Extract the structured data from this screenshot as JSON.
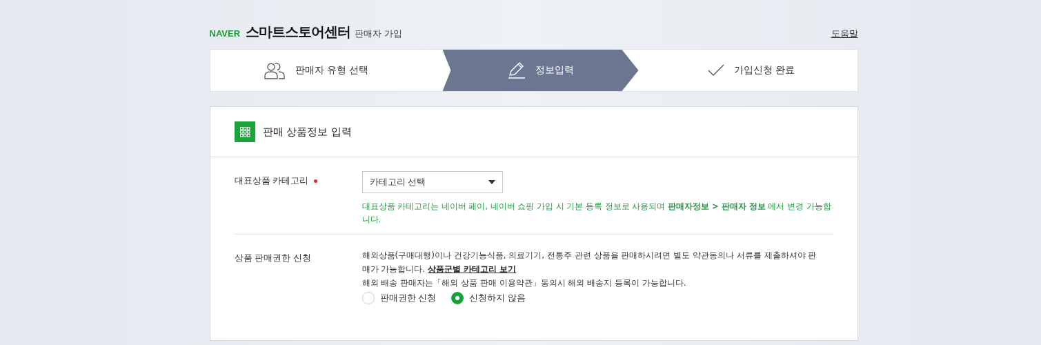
{
  "header": {
    "brand": "NAVER",
    "title": "스마트스토어센터",
    "subtitle": "판매자 가입",
    "help_link": "도움말"
  },
  "steps": [
    {
      "label": "판매자 유형 선택",
      "selected": false
    },
    {
      "label": "정보입력",
      "selected": true
    },
    {
      "label": "가입신청 완료",
      "selected": false
    }
  ],
  "section": {
    "title": "판매 상품정보 입력",
    "rows": [
      {
        "kind": "select",
        "label": "대표상품 카테고리",
        "required": true,
        "value": "카테고리 선택",
        "hint": "대표상품 카테고리는 네이버 페이, 네이버 쇼핑 가입 시 기본 등록 정보로 사용되며 **판매자정보 > 판매자 정보** 에서 변경 가능합니다."
      },
      {
        "kind": "radio",
        "label": "상품 판매권한 신청",
        "required": false,
        "text": "해외상품(구매대행)이나 건강기능식품, 의료기기, 전통주 관련 상품을 판매하시려면 별도 약관동의나 서류를 제출하셔야 판매가 가능합니다.",
        "link": "상품군별 카테고리 보기",
        "note": "해외 배송 판매자는「해외 상품 판매 이용약관」동의시 해외 배송지 등록이 가능합니다.",
        "options": [
          {
            "label": "판매권한 신청",
            "selected": false
          },
          {
            "label": "신청하지 않음",
            "selected": true
          }
        ]
      }
    ]
  }
}
